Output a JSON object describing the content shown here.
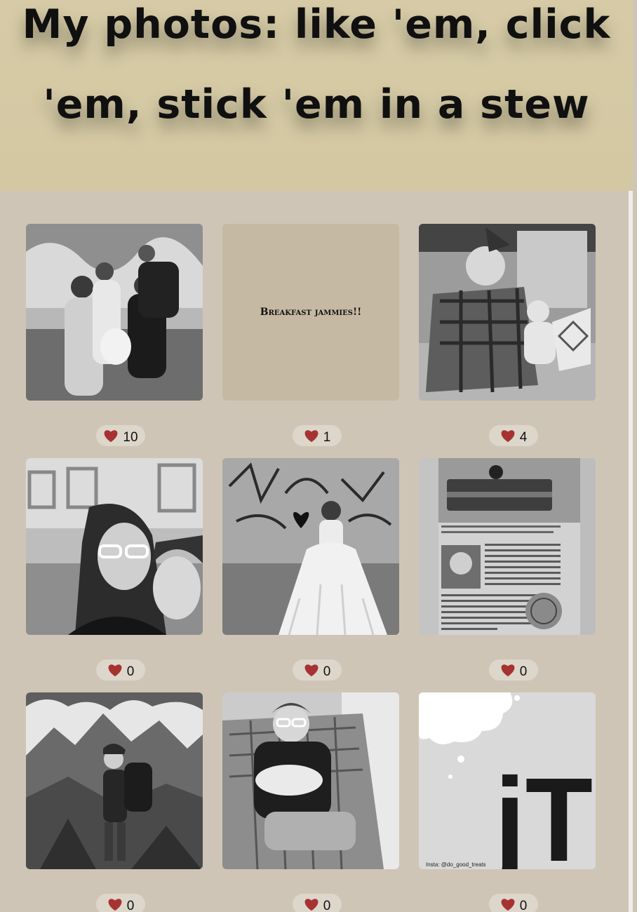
{
  "header": {
    "title": "My photos: like 'em, click 'em, stick 'em in a stew"
  },
  "colors": {
    "header_bg": "#d6cba6",
    "page_bg": "#cfc5b6",
    "heart": "#a63232",
    "like_pill": "#ddd6cb"
  },
  "photos": [
    {
      "kind": "photo",
      "likes": "10"
    },
    {
      "kind": "text",
      "text": "Breakfast jammies!!",
      "likes": "1"
    },
    {
      "kind": "photo",
      "likes": "4"
    },
    {
      "kind": "photo",
      "likes": "0"
    },
    {
      "kind": "photo",
      "likes": "0"
    },
    {
      "kind": "photo",
      "likes": "0"
    },
    {
      "kind": "photo",
      "likes": "0"
    },
    {
      "kind": "photo",
      "likes": "0"
    },
    {
      "kind": "logo",
      "logo_text": "jT",
      "caption": "Insta: @do_good_treats",
      "likes": "0"
    }
  ],
  "icons": {
    "like": "heart-icon"
  }
}
